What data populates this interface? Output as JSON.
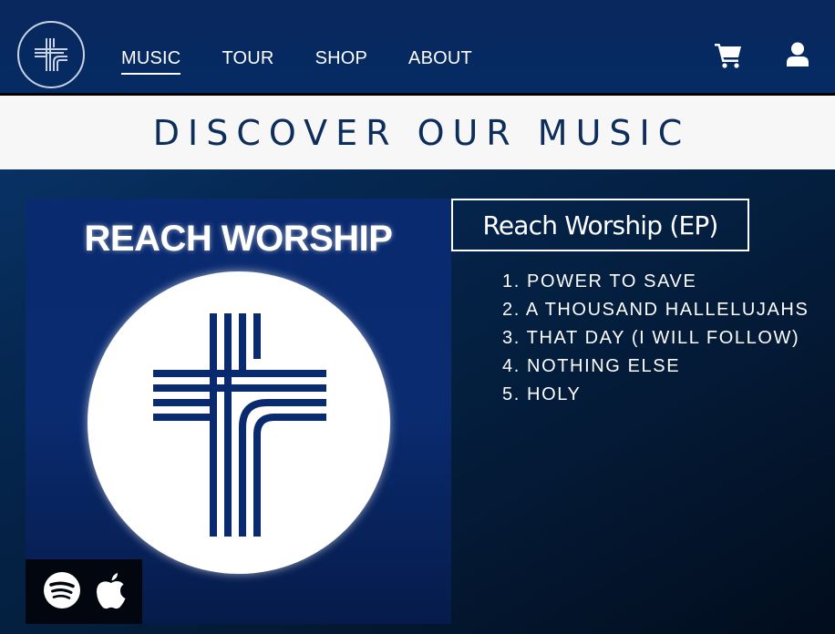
{
  "header": {
    "logo_icon": "cross-logo-icon",
    "nav": [
      {
        "label": "MUSIC",
        "active": true
      },
      {
        "label": "TOUR",
        "active": false
      },
      {
        "label": "SHOP",
        "active": false
      },
      {
        "label": "ABOUT",
        "active": false
      }
    ],
    "cart_icon": "cart-icon",
    "user_icon": "user-icon"
  },
  "banner": {
    "title": "DISCOVER OUR MUSIC"
  },
  "album": {
    "cover_text": "REACH WORSHIP",
    "title": "Reach Worship (EP)",
    "tracks": [
      "1. POWER TO SAVE",
      "2. A THOUSAND HALLELUJAHS",
      "3. THAT DAY (I WILL FOLLOW)",
      "4. NOTHING ELSE",
      "5. HOLY"
    ],
    "streaming": [
      {
        "service": "Spotify",
        "icon": "spotify-icon"
      },
      {
        "service": "Apple Music",
        "icon": "apple-icon"
      }
    ]
  },
  "colors": {
    "header_bg": "#08285e",
    "banner_bg": "#f7f7f7",
    "banner_text": "#0d2d5a",
    "cover_bg": "#0a2b70",
    "text": "#ffffff"
  }
}
